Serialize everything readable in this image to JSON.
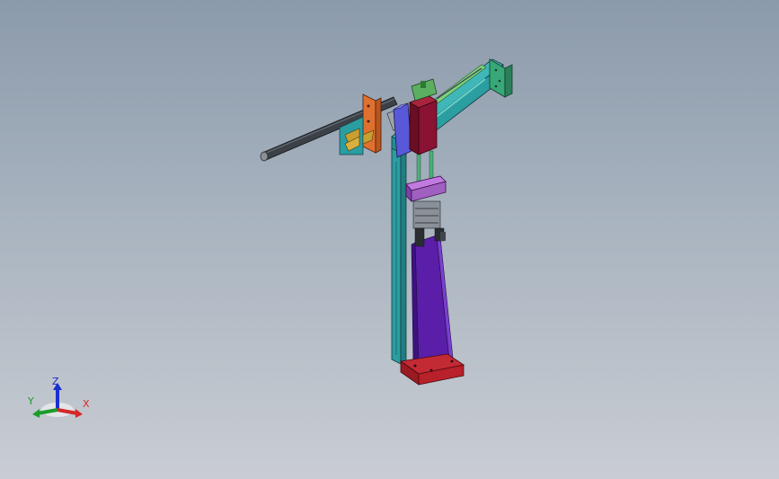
{
  "viewport": {
    "background_top": "#8b9aab",
    "background_bottom": "#c9cdd3"
  },
  "model": {
    "colors": {
      "frame": "#2a9ea0",
      "base_plate": "#b8202a",
      "column_support": "#5a1ea8",
      "carriage_block": "#8a1232",
      "cylinder": "#3c4148",
      "flange_bracket": "#e07030",
      "gripper_body": "#a060c0",
      "end_plate": "#38a878",
      "clamp_fingers": "#c8a030",
      "drive_block": "#5858d8",
      "rail_guide": "#6ac070"
    }
  },
  "triad": {
    "x_label": "X",
    "y_label": "Y",
    "z_label": "Z",
    "x_color": "#d4282a",
    "y_color": "#1c9c2a",
    "z_color": "#1a2fd0"
  }
}
